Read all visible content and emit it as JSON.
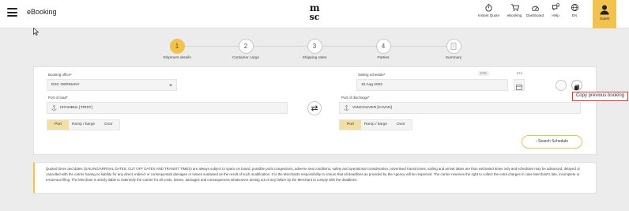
{
  "header": {
    "app_title": "eBooking",
    "logo_text": {
      "top": "m",
      "bottom": "sc"
    },
    "nav": [
      {
        "label": "Instant Quote",
        "icon": "stopwatch-icon"
      },
      {
        "label": "eBooking",
        "icon": "cart-icon"
      },
      {
        "label": "Dashboard",
        "icon": "dashboard-icon"
      },
      {
        "label": "Help",
        "icon": "help-chat-icon",
        "badge": "0"
      },
      {
        "label": "EN",
        "icon": "globe-icon"
      }
    ],
    "user": {
      "label": "Guest",
      "icon": "user-icon"
    }
  },
  "stepper": {
    "steps": [
      {
        "number": "1",
        "label": "Shipment details",
        "active": true
      },
      {
        "number": "2",
        "label": "Container cargo",
        "active": false
      },
      {
        "number": "3",
        "label": "Shipping rates",
        "active": false
      },
      {
        "number": "4",
        "label": "Parties",
        "active": false
      },
      {
        "number": "",
        "label": "Summary",
        "active": false,
        "icon": "document-icon"
      }
    ]
  },
  "form": {
    "booking_office": {
      "label": "Booking office*",
      "value": "DSC GERMANY"
    },
    "sailing_schedule": {
      "label": "Sailing schedule*",
      "value": "10 Aug 2022",
      "unit_options": [
        "ETD",
        "ETA"
      ]
    },
    "port_of_load": {
      "label": "Port of load*",
      "value": "ISTANBUL [TRIST]"
    },
    "port_of_discharge": {
      "label": "Port of discharge*",
      "value": "VANCOUVER [CAVAN]"
    },
    "load_modes": [
      "Port",
      "Ramp / barge",
      "Door"
    ],
    "discharge_modes": [
      "Port",
      "Ramp / barge",
      "Door"
    ],
    "search_label": "Search Schedule",
    "copy_tooltip": "Copy previous booking"
  },
  "disclaimer": "Quoted times and dates (SAILING/ARRIVAL DATES, CUT OFF DATES AND TRANSIT TIMES) are always subject to space on board, possible ports congestions, adverse sea conditions, safety and operational consideration. Advertised transit times, sailing and arrival dates are thus estimated times only and schedules may be advanced, delayed or cancelled with the carrier having no liability for any direct, indirect or consequential damages or losses sustained as the result of such modification. It is the Merchants responsibility to ensure that all deadlines as provided by the Agency will be respected. The carrier reserves the right to collect the extra charges in case Merchant's late, incomplete or erroneous filing. The Merchant is strictly liable to indemnify the Carrier for all costs, losses, damages and consequences whatsoever arising out of any failure by the Merchant to comply with the deadlines.",
  "colors": {
    "accent": "#f2c14e",
    "selected_segment": "#f2dfa4",
    "highlight_border": "#d53b3b"
  }
}
